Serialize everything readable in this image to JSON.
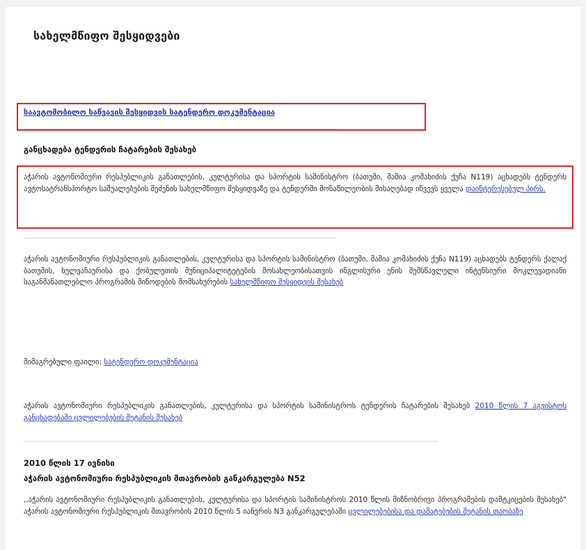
{
  "page": {
    "title": "სახელმწიფო შესყიდვები"
  },
  "section_link": "საავტომობილო საწვავის შესყიდვის სატენდერო დოკუმენტაცია",
  "announcement": {
    "heading": "განცხადება ტენდერის ჩატარების შესახებ",
    "text": "აჭარის ავტონომიური რესპუბლიკის განათლების, კულტურისა და სპორტის სამინისტრო (ბათუმი, მაშია კომახიძის ქუჩა N119) აცხადებს ტენდერს ავტოსატრანსპორტო საშუალებების შეძენის სახელმწიფო შესყიდვაზე და ტენდერში მონაწილეობის მისაღებად იწვევს ყველა ",
    "link": "დაინტერესებულ პირს."
  },
  "notice2": {
    "text": "აჭარის ავტონომიური რესპუბლიკის განათლების, კულტურისა და სპორტის სამინისტრო (ბათუმი, მაშია კომახიძის ქუჩა N119) აცხადებს ტენდერს ქალაქ ბათუმის, ხელვაჩაურისა და ქობულეთის მუნიციპალიტეტების მოსახლეობისათვის ინგლისური ენის შემსწავლელი ინტენსიური მოკლევადიანი საგანმანათლებლო პროგრამის მიწოდების მომსახურების ",
    "link": "სახელმწიფო შესყიდვის შესახებ"
  },
  "attached": {
    "label": "მიმაგრებული ფაილი: ",
    "link": "სატენდერო დოკუმენტაცია"
  },
  "changes": {
    "text": "აჭარის ავტონომიური რესპუბლიკის განათლების, კულტურისა და სპორტის სამინისტროს ტენდერის ჩატარების შესახებ ",
    "link": "2010 წლის 7 აგვისტოს განცხადებაში ცვლილებების შეტანის შესახებ"
  },
  "decree": {
    "date": "2010 წლის 17 ივნისი",
    "title": "აჭარის ავტონომიური რესპუბლიკის მთავრობის განკარგულება N52",
    "text": ",,აჭარის ავტონომიური რესპუბლიკის განათლების, კულტურისა და სპორტის სამინისტროს 2010 წლის მიზნობრივი პროგრამების დამტკიცების შესახებ\" აჭარის ავტონომიური რესპუბლიკის მთავრობის 2010 წლის 5 იანვრის N3 განკარგულებაში ",
    "link": "ცვლილებებისა და დამატებების შეტანის თაობაზე"
  },
  "colors": {
    "link": "#2636b8",
    "highlight": "#e0242c",
    "background": "#f3f3f3"
  }
}
